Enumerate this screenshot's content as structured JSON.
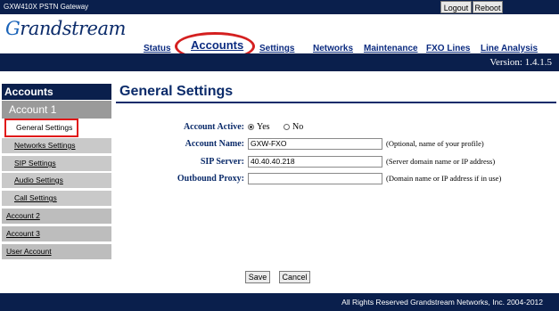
{
  "header": {
    "model": "GXW410X PSTN Gateway",
    "logout_label": "Logout",
    "reboot_label": "Reboot",
    "logo_text": "randstream",
    "logo_initial": "G",
    "version": "Version: 1.4.1.5"
  },
  "nav": {
    "status": "Status",
    "accounts": "Accounts",
    "settings": "Settings",
    "networks": "Networks",
    "maintenance": "Maintenance",
    "fxo_lines": "FXO Lines",
    "line_analysis": "Line Analysis"
  },
  "sidebar": {
    "heading": "Accounts",
    "account1": "Account 1",
    "items": [
      "General Settings",
      "Networks Settings",
      "SIP Settings",
      "Audio Settings",
      "Call Settings",
      "Account 2",
      "Account 3",
      "User Account"
    ]
  },
  "main": {
    "title": "General Settings",
    "account_active": {
      "label": "Account Active:",
      "yes": "Yes",
      "no": "No",
      "selected": "Yes"
    },
    "account_name": {
      "label": "Account Name:",
      "value": "GXW-FXO",
      "hint": "(Optional, name of your profile)"
    },
    "sip_server": {
      "label": "SIP Server:",
      "value": "40.40.40.218",
      "hint": "(Server domain name or IP address)"
    },
    "outbound_proxy": {
      "label": "Outbound Proxy:",
      "value": "",
      "hint": "(Domain name or IP address if in use)"
    },
    "save_label": "Save",
    "cancel_label": "Cancel"
  },
  "footer": {
    "copyright": "All Rights Reserved Grandstream Networks, Inc. 2004-2012"
  }
}
